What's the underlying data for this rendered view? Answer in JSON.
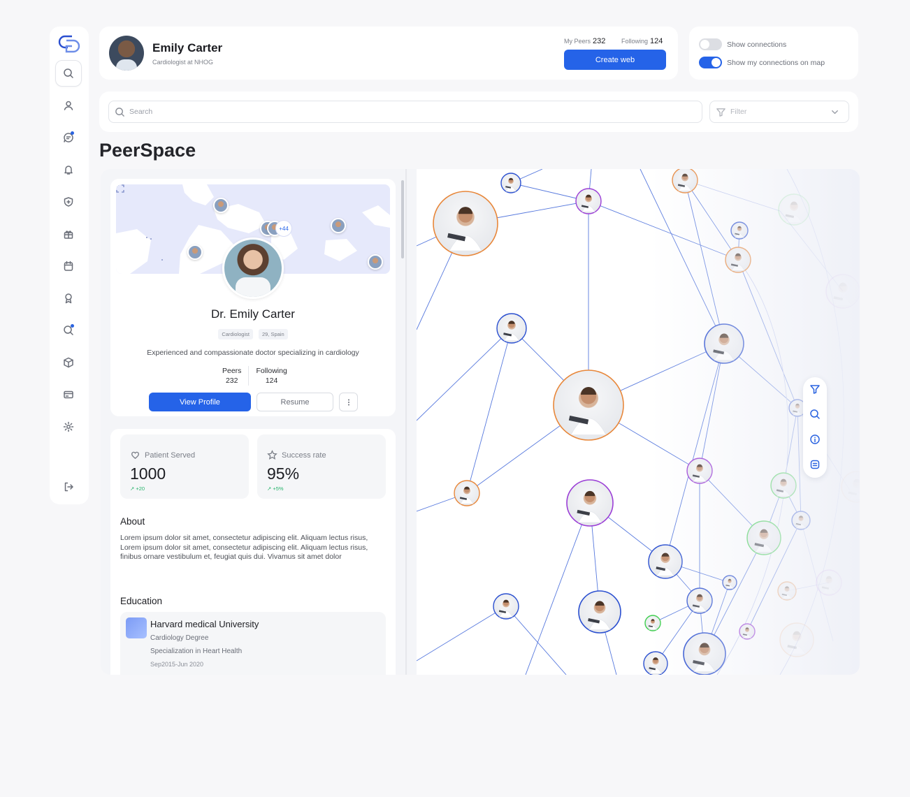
{
  "user": {
    "name": "Emily Carter",
    "role": "Cardiologist at NHOG",
    "peers_label": "My Peers",
    "peers_value": "232",
    "following_label": "Following",
    "following_value": "124",
    "create_button": "Create web"
  },
  "toggles": {
    "show_connections": {
      "label": "Show connections",
      "on": false
    },
    "show_my_connections": {
      "label": "Show my connections on map",
      "on": true
    }
  },
  "search": {
    "placeholder": "Search",
    "filter_placeholder": "Filter"
  },
  "page_title": "PeerSpace",
  "profile": {
    "map_count_badge": "+44",
    "name": "Dr. Emily Carter",
    "tags": [
      "Cardiologist",
      "29, Spain"
    ],
    "description": "Experienced and compassionate doctor specializing in cardiology",
    "peers_label": "Peers",
    "peers_value": "232",
    "following_label": "Following",
    "following_value": "124",
    "view_profile": "View Profile",
    "resume": "Resume",
    "more_icon": "more-vertical-icon"
  },
  "kpis": [
    {
      "label": "Patient Served",
      "value": "1000",
      "delta": "+20",
      "icon": "heart-hand-icon"
    },
    {
      "label": "Success rate",
      "value": "95%",
      "delta": "+5%",
      "icon": "star-icon"
    }
  ],
  "about": {
    "title": "About",
    "line1": "Lorem ipsum dolor sit amet, consectetur adipiscing elit. Aliquam lectus risus,",
    "line2": "Lorem ipsum dolor sit amet, consectetur adipiscing elit. Aliquam lectus risus, finibus ornare vestibulum et, feugiat quis dui. Vivamus sit amet dolor"
  },
  "education": {
    "title": "Education",
    "school": "Harvard medical University",
    "degree": "Cardiology Degree",
    "specialization": "Specialization in Heart Health",
    "dates": "Sep2015-Jun 2020"
  },
  "sidebar_icons": [
    "search-icon",
    "user-icon",
    "chat-icon",
    "bell-icon",
    "shield-icon",
    "gift-icon",
    "calendar-icon",
    "award-icon",
    "search-activity-icon",
    "box-icon",
    "card-icon",
    "settings-icon",
    "logout-icon"
  ],
  "network_tools": [
    "filter-icon",
    "search-icon",
    "info-icon",
    "network-icon"
  ],
  "colors": {
    "accent": "#2563e8",
    "orange_ring": "#e8873a",
    "purple_ring": "#9b3ed6",
    "green_ring": "#3fcf4f",
    "blue_ring": "#2a4fd0",
    "success": "#26b36b"
  }
}
